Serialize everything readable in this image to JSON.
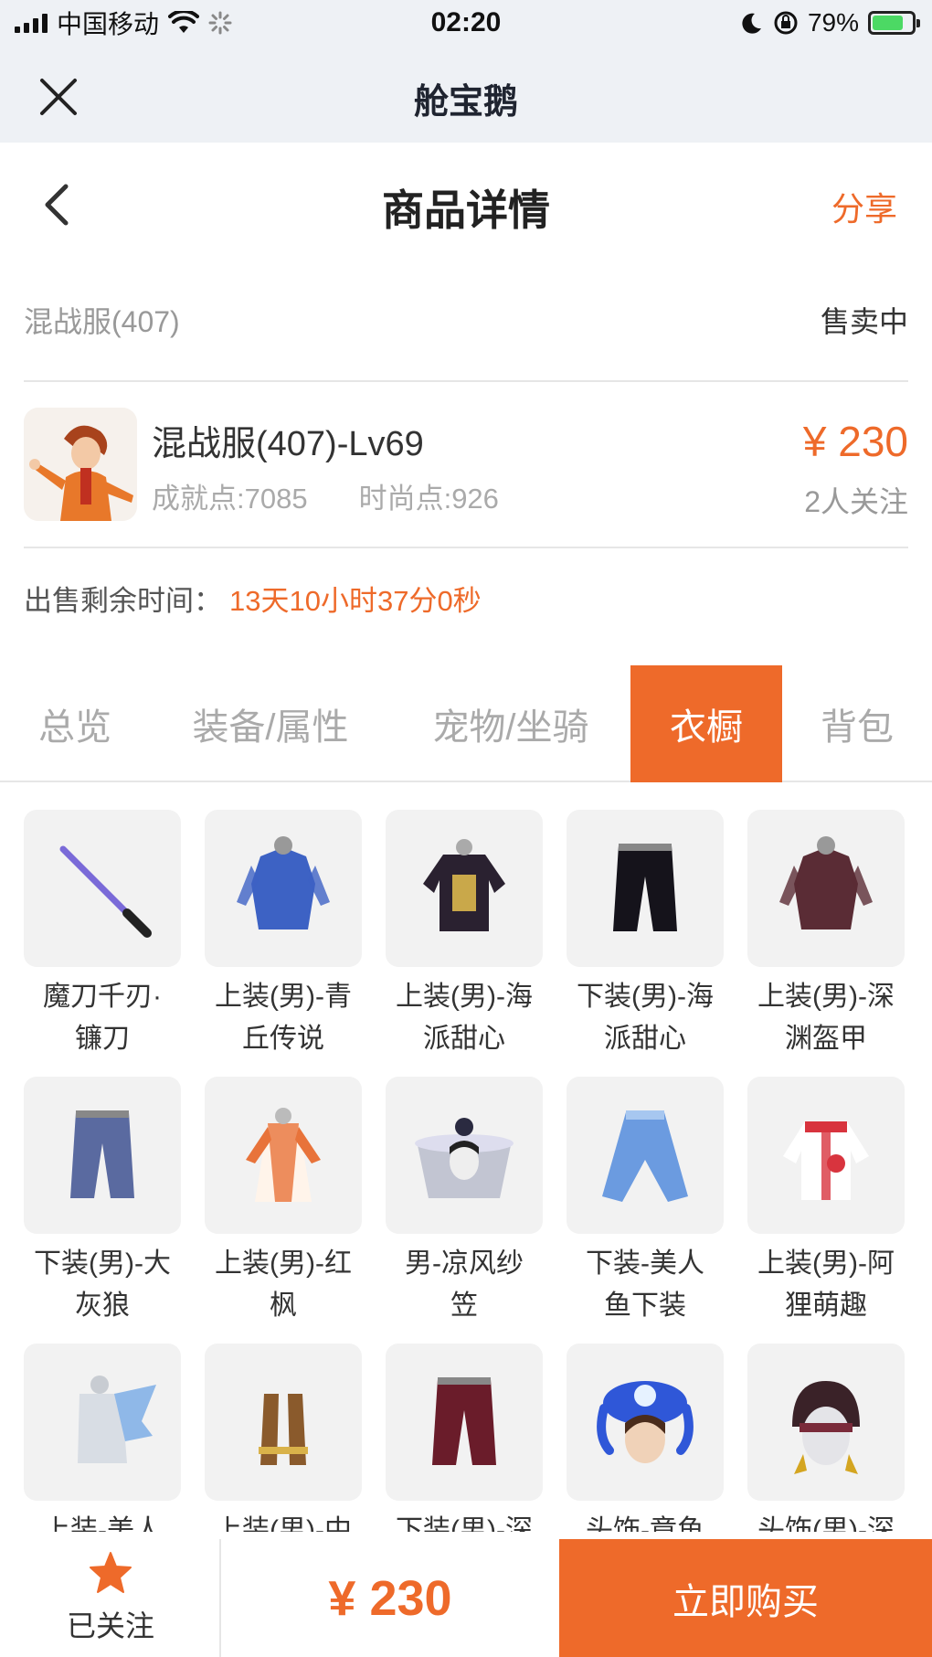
{
  "status_bar": {
    "carrier": "中国移动",
    "time": "02:20",
    "battery": "79%",
    "battery_level": 0.79
  },
  "app": {
    "title": "舱宝鹅"
  },
  "page": {
    "title": "商品详情",
    "share_label": "分享"
  },
  "listing": {
    "server": "混战服(407)",
    "status": "售卖中",
    "product_title": "混战服(407)-Lv69",
    "achievement": "成就点:7085",
    "fashion": "时尚点:926",
    "price": "¥ 230",
    "followers": "2人关注",
    "remaining_label": "出售剩余时间：",
    "remaining_value": "13天10小时37分0秒"
  },
  "tabs": [
    {
      "label": "总览",
      "active": false
    },
    {
      "label": "装备/属性",
      "active": false
    },
    {
      "label": "宠物/坐骑",
      "active": false
    },
    {
      "label": "衣橱",
      "active": true
    },
    {
      "label": "背包",
      "active": false
    }
  ],
  "wardrobe": [
    {
      "line1": "魔刀千刃·",
      "line2": "镰刀",
      "icon": "blade-icon",
      "color": "#7a6ad8"
    },
    {
      "line1": "上装(男)-青",
      "line2": "丘传说",
      "icon": "armor-icon",
      "color": "#3d62c4"
    },
    {
      "line1": "上装(男)-海",
      "line2": "派甜心",
      "icon": "jacket-icon",
      "color": "#2a2130"
    },
    {
      "line1": "下装(男)-海",
      "line2": "派甜心",
      "icon": "pants-icon",
      "color": "#15131b"
    },
    {
      "line1": "上装(男)-深",
      "line2": "渊盔甲",
      "icon": "armor-icon",
      "color": "#5a2c35"
    },
    {
      "line1": "下装(男)-大",
      "line2": "灰狼",
      "icon": "pants-icon",
      "color": "#5a6aa0"
    },
    {
      "line1": "上装(男)-红",
      "line2": "枫",
      "icon": "robe-icon",
      "color": "#e8733a"
    },
    {
      "line1": "男-凉风纱",
      "line2": "笠",
      "icon": "hat-icon",
      "color": "#9aa0b8"
    },
    {
      "line1": "下装-美人",
      "line2": "鱼下装",
      "icon": "skirt-icon",
      "color": "#6b9be0"
    },
    {
      "line1": "上装(男)-阿",
      "line2": "狸萌趣",
      "icon": "hoodie-icon",
      "color": "#d8343e"
    },
    {
      "line1": "上装-美人",
      "line2": "",
      "icon": "wing-top-icon",
      "color": "#8fb8e8"
    },
    {
      "line1": "上装(男)-中",
      "line2": "",
      "icon": "vest-icon",
      "color": "#8a5a2c"
    },
    {
      "line1": "下装(男)-深",
      "line2": "",
      "icon": "pants-icon",
      "color": "#6a1c2a"
    },
    {
      "line1": "头饰-章鱼",
      "line2": "",
      "icon": "octopus-hat-icon",
      "color": "#2f57d8"
    },
    {
      "line1": "头饰(男)-深",
      "line2": "",
      "icon": "helmet-icon",
      "color": "#3a2228"
    }
  ],
  "bottom": {
    "follow_label": "已关注",
    "price": "¥ 230",
    "buy_label": "立即购买"
  }
}
